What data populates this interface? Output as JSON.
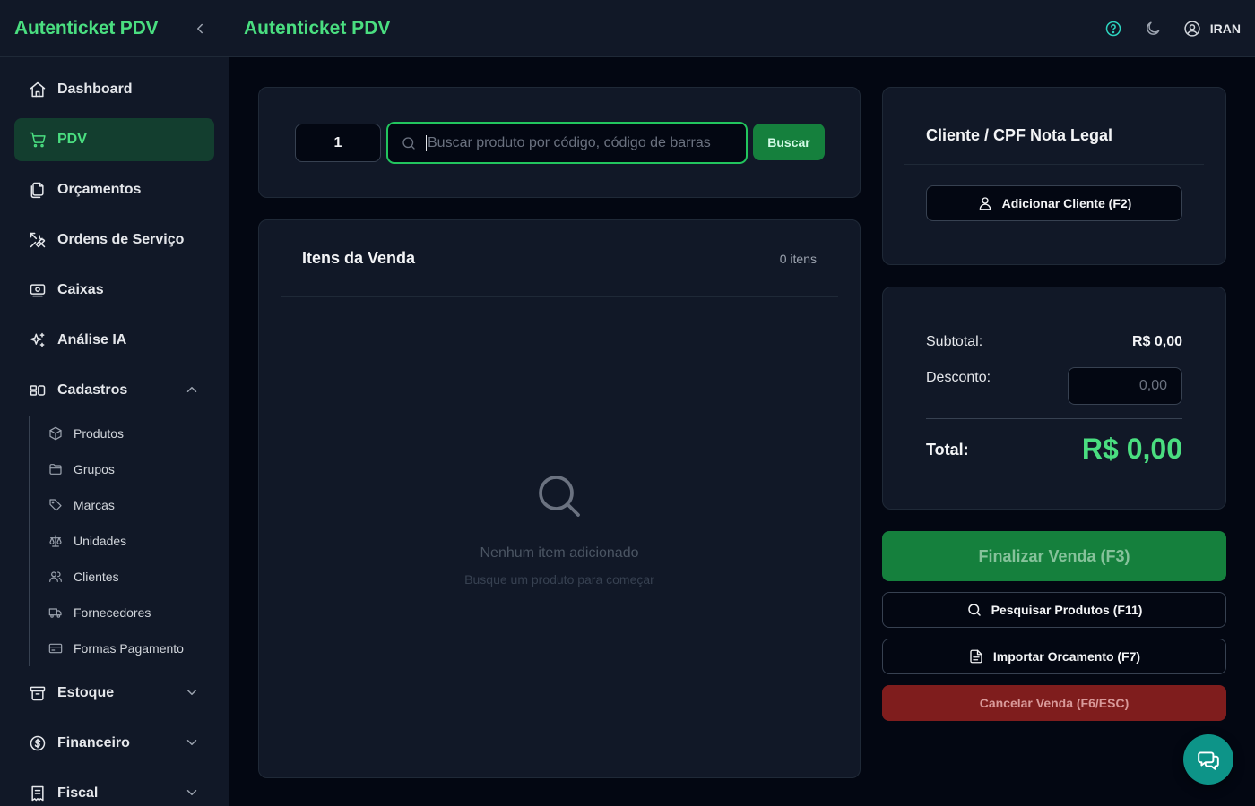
{
  "app": {
    "brand": "Autenticket PDV",
    "title": "Autenticket PDV"
  },
  "user": {
    "name": "IRAN"
  },
  "colors": {
    "accent": "#4ade80",
    "primary_button": "#15803d",
    "danger_button": "#7f1d1d",
    "background": "#030712",
    "surface": "#111827",
    "fab": "#0d9488"
  },
  "sidebar": {
    "items": [
      {
        "label": "Dashboard",
        "icon": "home-icon"
      },
      {
        "label": "PDV",
        "icon": "cart-icon",
        "active": true
      },
      {
        "label": "Orçamentos",
        "icon": "files-icon"
      },
      {
        "label": "Ordens de Serviço",
        "icon": "tools-icon"
      },
      {
        "label": "Caixas",
        "icon": "cash-register-icon"
      },
      {
        "label": "Análise IA",
        "icon": "sparkles-icon"
      },
      {
        "label": "Cadastros",
        "icon": "grid-icon",
        "expanded": true
      }
    ],
    "cadastros_sub": [
      {
        "label": "Produtos",
        "icon": "box-icon"
      },
      {
        "label": "Grupos",
        "icon": "folder-icon"
      },
      {
        "label": "Marcas",
        "icon": "tag-icon"
      },
      {
        "label": "Unidades",
        "icon": "scale-icon"
      },
      {
        "label": "Clientes",
        "icon": "users-icon"
      },
      {
        "label": "Fornecedores",
        "icon": "truck-icon"
      },
      {
        "label": "Formas Pagamento",
        "icon": "credit-card-icon"
      }
    ],
    "bottom_items": [
      {
        "label": "Estoque",
        "icon": "archive-icon"
      },
      {
        "label": "Financeiro",
        "icon": "dollar-circle-icon"
      },
      {
        "label": "Fiscal",
        "icon": "receipt-icon"
      }
    ]
  },
  "search": {
    "quantity": "1",
    "placeholder": "Buscar produto por código, código de barras",
    "button": "Buscar"
  },
  "items": {
    "title": "Itens da Venda",
    "count": "0 itens",
    "empty_title": "Nenhum item adicionado",
    "empty_subtitle": "Busque um produto para começar"
  },
  "client": {
    "title": "Cliente / CPF Nota Legal",
    "add_button": "Adicionar Cliente (F2)"
  },
  "totals": {
    "subtotal_label": "Subtotal:",
    "subtotal_value": "R$ 0,00",
    "discount_label": "Desconto:",
    "discount_placeholder": "0,00",
    "total_label": "Total:",
    "total_value": "R$ 0,00"
  },
  "actions": {
    "finalize": "Finalizar Venda (F3)",
    "search_products": "Pesquisar Produtos (F11)",
    "import_quote": "Importar Orcamento (F7)",
    "cancel": "Cancelar Venda (F6/ESC)"
  }
}
